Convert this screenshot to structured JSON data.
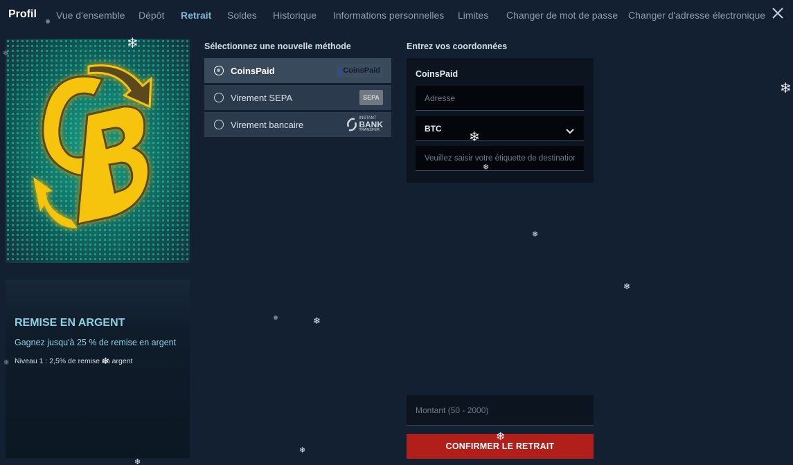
{
  "header": {
    "title": "Profil",
    "tabs": [
      {
        "label": "Vue d'ensemble",
        "active": false
      },
      {
        "label": "Dépôt",
        "active": false
      },
      {
        "label": "Retrait",
        "active": true
      },
      {
        "label": "Soldes",
        "active": false
      },
      {
        "label": "Historique",
        "active": false
      },
      {
        "label": "Informations personnelles",
        "active": false
      },
      {
        "label": "Limites",
        "active": false
      },
      {
        "label": "Changer de mot de passe",
        "active": false
      },
      {
        "label": "Changer d'adresse électronique",
        "active": false
      }
    ],
    "close_icon": "close-icon"
  },
  "promo": {
    "logo_text": "CB",
    "heading": "REMISE EN ARGENT",
    "subtitle": "Gagnez jusqu'à 25 % de remise en argent",
    "level": "Niveau 1 : 2,5% de remise en argent"
  },
  "methods": {
    "label": "Sélectionnez une nouvelle méthode",
    "items": [
      {
        "name": "CoinsPaid",
        "selected": true,
        "logo_text": "CoinsPaid",
        "logo_icon": "coinspaid-logo"
      },
      {
        "name": "Virement SEPA",
        "selected": false,
        "logo_text": "SEPA",
        "logo_icon": "sepa-logo"
      },
      {
        "name": "Virement bancaire",
        "selected": false,
        "logo_text": [
          "INSTANT",
          "BANK",
          "TRANSFER"
        ],
        "logo_icon": "instant-bank-transfer-logo"
      }
    ]
  },
  "details": {
    "label": "Entrez vos coordonnées",
    "provider": "CoinsPaid",
    "address_placeholder": "Adresse",
    "currency_value": "BTC",
    "tag_placeholder": "Veuillez saisir votre étiquette de destination"
  },
  "amount": {
    "placeholder": "Montant (50 - 2000)"
  },
  "confirm_label": "CONFIRMER LE RETRAIT",
  "colors": {
    "background": "#132031",
    "active_tab": "#7fb6d6",
    "confirm": "#b01f1a",
    "logo_yellow": "#f7c410"
  }
}
